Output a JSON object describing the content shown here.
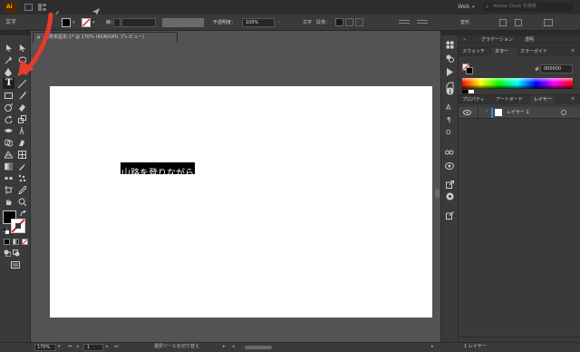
{
  "app": {
    "logo": "Ai",
    "workspace": "Web",
    "search_placeholder": "Adobe Stock を検索"
  },
  "control_bar": {
    "tool_label": "文字",
    "stroke_label": "線：",
    "opacity_label": "不透明度：",
    "opacity_value": "100%",
    "char_label": "文字",
    "para_label": "段落：",
    "transform_label": "変形"
  },
  "document": {
    "tab_title": "名称未設定-1* @ 170% (RGB/GPU プレビュー)",
    "text_content": "山路を登りながら"
  },
  "panels": {
    "top_tabs": [
      "グラデーション",
      "透明"
    ],
    "color_tabs": [
      "スウォッチ",
      "カラー",
      "カラーガイド"
    ],
    "active_color_tab": "カラー",
    "hex_prefix": "#",
    "hex_value": "000000",
    "layers_tabs": [
      "プロパティ",
      "アートボード",
      "レイヤー"
    ],
    "active_layers_tab": "レイヤー",
    "layer_name": "レイヤー 1",
    "layer_count": "1 レイヤー"
  },
  "status_bar": {
    "zoom": "170%",
    "page": "1",
    "status_text": "選択ツールを切り替え"
  },
  "colors": {
    "accent": "#1d7bd6",
    "annotation_arrow": "#e63b2e",
    "layer_color": "#3f84f5"
  }
}
